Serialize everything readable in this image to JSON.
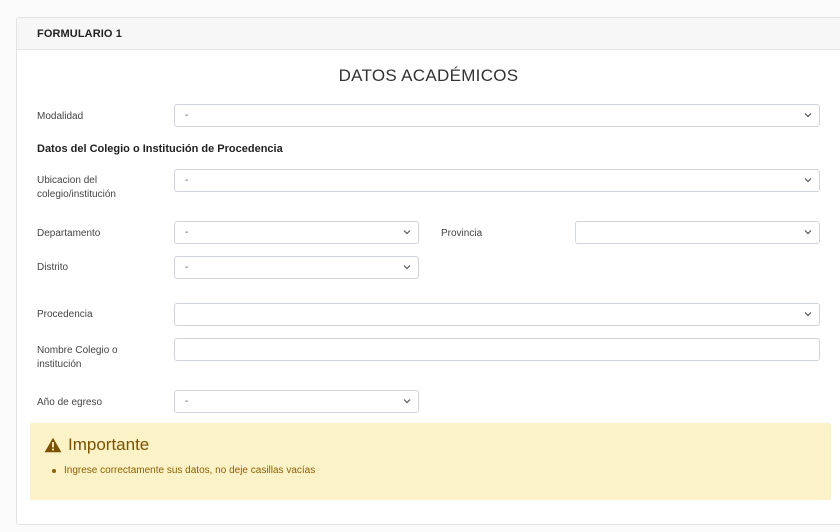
{
  "header": {
    "title": "FORMULARIO 1"
  },
  "section": {
    "title": "DATOS ACADÉMICOS"
  },
  "fields": {
    "modalidad": {
      "label": "Modalidad",
      "value": "-"
    },
    "subheading": "Datos del Colegio o Institución de Procedencia",
    "ubicacion": {
      "label_line1": "Ubicacion del",
      "label_line2": "colegio/institución",
      "value": "-"
    },
    "departamento": {
      "label": "Departamento",
      "value": "-"
    },
    "provincia": {
      "label": "Provincia",
      "value": ""
    },
    "distrito": {
      "label": "Distrito",
      "value": "-"
    },
    "procedencia": {
      "label": "Procedencia",
      "value": ""
    },
    "nombre_colegio": {
      "label_line1": "Nombre Colegio o",
      "label_line2": "institución",
      "value": ""
    },
    "anio_egreso": {
      "label": "Año de egreso",
      "value": "-"
    }
  },
  "alert": {
    "title": "Importante",
    "items": [
      "Ingrese correctamente sus datos, no deje casillas vacías"
    ],
    "color": "#fcf2c8",
    "text_color": "#7a5200"
  },
  "icons": {
    "alert": "warning-triangle-icon",
    "select": "chevron-down-icon"
  }
}
